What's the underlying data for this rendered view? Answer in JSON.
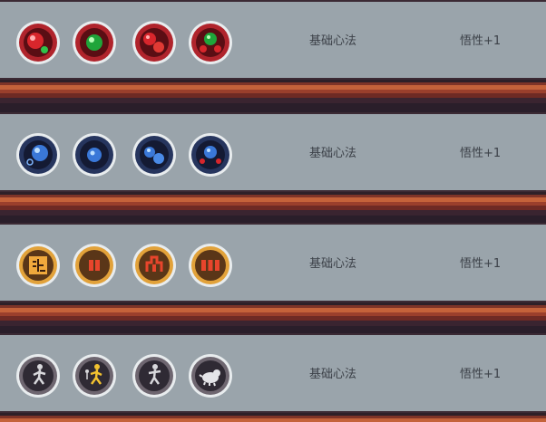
{
  "rows": [
    {
      "theme": "red",
      "ring_color": "#b0242c",
      "ring_inner": "#5a0e14",
      "icons": [
        "red-orb-icon",
        "green-orb-icon",
        "twin-red-orb-icon",
        "green-orb-cluster-icon"
      ],
      "name": "基础心法",
      "bonus": "悟性+1"
    },
    {
      "theme": "blue",
      "ring_color": "#26355e",
      "ring_inner": "#141a33",
      "icons": [
        "blue-orb-icon",
        "blue-orb-dot-icon",
        "twin-blue-orb-icon",
        "blue-orb-cluster-icon"
      ],
      "name": "基础心法",
      "bonus": "悟性+1"
    },
    {
      "theme": "gold",
      "ring_color": "#e2a23a",
      "ring_inner": "#5a3618",
      "icons": [
        "talisman-glyph-icon",
        "talisman-scroll-icon",
        "talisman-gate-icon",
        "talisman-triple-icon"
      ],
      "name": "基础心法",
      "bonus": "悟性+1"
    },
    {
      "theme": "grey",
      "ring_color": "#6e6670",
      "ring_inner": "#2f2a34",
      "icons": [
        "stance-figure-icon",
        "golden-figure-icon",
        "stance-figure-alt-icon",
        "white-beast-icon"
      ],
      "name": "基础心法",
      "bonus": "悟性+1"
    }
  ]
}
